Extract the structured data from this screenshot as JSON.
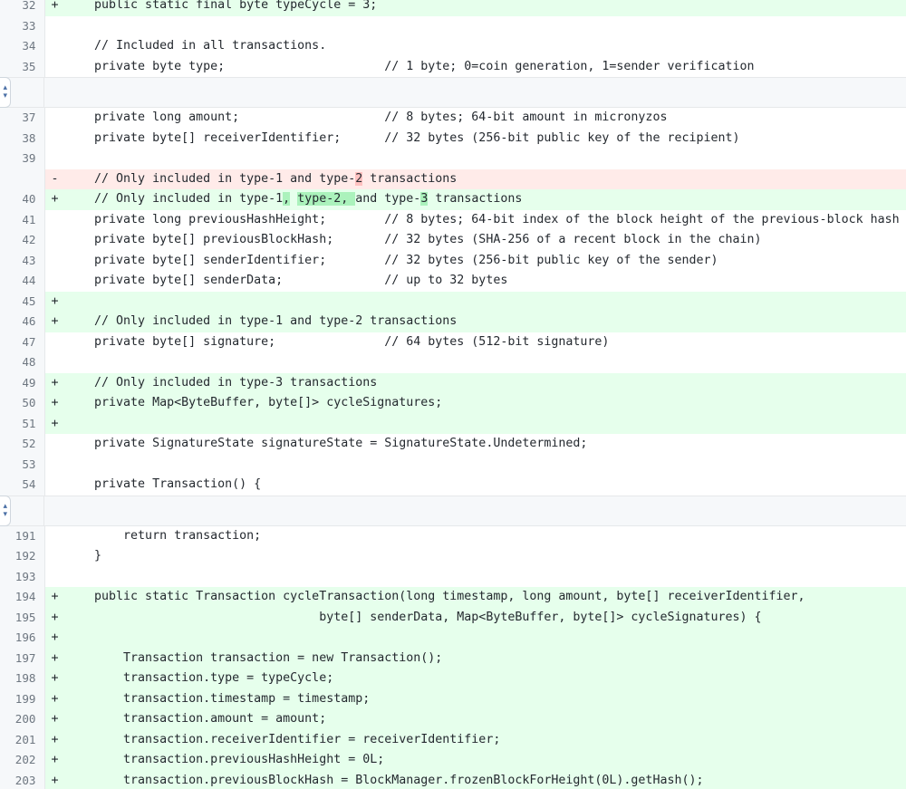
{
  "view": {
    "type": "unified-diff",
    "language": "java",
    "colors": {
      "addition_bg": "#e6ffec",
      "deletion_bg": "#ffebe9",
      "addition_word_bg": "#abf2bc",
      "deletion_word_bg": "#ffc1c0",
      "context_bg": "#ffffff",
      "gutter_bg": "#f6f8fa",
      "text": "#24292f",
      "line_number": "#6e7781",
      "border": "#e6e8ea"
    }
  },
  "expanders": [
    {
      "name": "expand-up-down-1",
      "glyph_top": "▴",
      "glyph_bottom": "▾"
    },
    {
      "name": "expand-up-down-2",
      "glyph_top": "▴",
      "glyph_bottom": "▾"
    }
  ],
  "rows": [
    {
      "num": "32",
      "marker": "+",
      "kind": "add",
      "segments": [
        {
          "text": "    public static final byte typeCycle = 3;"
        }
      ]
    },
    {
      "num": "33",
      "marker": "",
      "kind": "ctx",
      "segments": [
        {
          "text": ""
        }
      ]
    },
    {
      "num": "34",
      "marker": "",
      "kind": "ctx",
      "segments": [
        {
          "text": "    // Included in all transactions."
        }
      ]
    },
    {
      "num": "35",
      "marker": "",
      "kind": "ctx",
      "segments": [
        {
          "text": "    private byte type;                      // 1 byte; 0=coin generation, 1=sender verification"
        }
      ]
    },
    {
      "hunk": true
    },
    {
      "num": "37",
      "marker": "",
      "kind": "ctx",
      "segments": [
        {
          "text": "    private long amount;                    // 8 bytes; 64-bit amount in micronyzos"
        }
      ]
    },
    {
      "num": "38",
      "marker": "",
      "kind": "ctx",
      "segments": [
        {
          "text": "    private byte[] receiverIdentifier;      // 32 bytes (256-bit public key of the recipient)"
        }
      ]
    },
    {
      "num": "39",
      "marker": "",
      "kind": "ctx",
      "segments": [
        {
          "text": ""
        }
      ]
    },
    {
      "num": "",
      "marker": "-",
      "kind": "del",
      "segments": [
        {
          "text": "    // Only included in type-1 and type-"
        },
        {
          "text": "2",
          "hl": "del"
        },
        {
          "text": " transactions"
        }
      ]
    },
    {
      "num": "40",
      "marker": "+",
      "kind": "add",
      "segments": [
        {
          "text": "    // Only included in type-1"
        },
        {
          "text": ",",
          "hl": "add"
        },
        {
          "text": " "
        },
        {
          "text": "type-2, ",
          "hl": "add"
        },
        {
          "text": "and type-"
        },
        {
          "text": "3",
          "hl": "add"
        },
        {
          "text": " transactions"
        }
      ]
    },
    {
      "num": "41",
      "marker": "",
      "kind": "ctx",
      "segments": [
        {
          "text": "    private long previousHashHeight;        // 8 bytes; 64-bit index of the block height of the previous-block hash"
        }
      ]
    },
    {
      "num": "42",
      "marker": "",
      "kind": "ctx",
      "segments": [
        {
          "text": "    private byte[] previousBlockHash;       // 32 bytes (SHA-256 of a recent block in the chain)"
        }
      ]
    },
    {
      "num": "43",
      "marker": "",
      "kind": "ctx",
      "segments": [
        {
          "text": "    private byte[] senderIdentifier;        // 32 bytes (256-bit public key of the sender)"
        }
      ]
    },
    {
      "num": "44",
      "marker": "",
      "kind": "ctx",
      "segments": [
        {
          "text": "    private byte[] senderData;              // up to 32 bytes"
        }
      ]
    },
    {
      "num": "45",
      "marker": "+",
      "kind": "add",
      "segments": [
        {
          "text": ""
        }
      ]
    },
    {
      "num": "46",
      "marker": "+",
      "kind": "add",
      "segments": [
        {
          "text": "    // Only included in type-1 and type-2 transactions"
        }
      ]
    },
    {
      "num": "47",
      "marker": "",
      "kind": "ctx",
      "segments": [
        {
          "text": "    private byte[] signature;               // 64 bytes (512-bit signature)"
        }
      ]
    },
    {
      "num": "48",
      "marker": "",
      "kind": "ctx",
      "segments": [
        {
          "text": ""
        }
      ]
    },
    {
      "num": "49",
      "marker": "+",
      "kind": "add",
      "segments": [
        {
          "text": "    // Only included in type-3 transactions"
        }
      ]
    },
    {
      "num": "50",
      "marker": "+",
      "kind": "add",
      "segments": [
        {
          "text": "    private Map<ByteBuffer, byte[]> cycleSignatures;"
        }
      ]
    },
    {
      "num": "51",
      "marker": "+",
      "kind": "add",
      "segments": [
        {
          "text": ""
        }
      ]
    },
    {
      "num": "52",
      "marker": "",
      "kind": "ctx",
      "segments": [
        {
          "text": "    private SignatureState signatureState = SignatureState.Undetermined;"
        }
      ]
    },
    {
      "num": "53",
      "marker": "",
      "kind": "ctx",
      "segments": [
        {
          "text": ""
        }
      ]
    },
    {
      "num": "54",
      "marker": "",
      "kind": "ctx",
      "segments": [
        {
          "text": "    private Transaction() {"
        }
      ]
    },
    {
      "hunk": true
    },
    {
      "num": "191",
      "marker": "",
      "kind": "ctx",
      "segments": [
        {
          "text": "        return transaction;"
        }
      ]
    },
    {
      "num": "192",
      "marker": "",
      "kind": "ctx",
      "segments": [
        {
          "text": "    }"
        }
      ]
    },
    {
      "num": "193",
      "marker": "",
      "kind": "ctx",
      "segments": [
        {
          "text": ""
        }
      ]
    },
    {
      "num": "194",
      "marker": "+",
      "kind": "add",
      "segments": [
        {
          "text": "    public static Transaction cycleTransaction(long timestamp, long amount, byte[] receiverIdentifier,"
        }
      ]
    },
    {
      "num": "195",
      "marker": "+",
      "kind": "add",
      "segments": [
        {
          "text": "                                   byte[] senderData, Map<ByteBuffer, byte[]> cycleSignatures) {"
        }
      ]
    },
    {
      "num": "196",
      "marker": "+",
      "kind": "add",
      "segments": [
        {
          "text": ""
        }
      ]
    },
    {
      "num": "197",
      "marker": "+",
      "kind": "add",
      "segments": [
        {
          "text": "        Transaction transaction = new Transaction();"
        }
      ]
    },
    {
      "num": "198",
      "marker": "+",
      "kind": "add",
      "segments": [
        {
          "text": "        transaction.type = typeCycle;"
        }
      ]
    },
    {
      "num": "199",
      "marker": "+",
      "kind": "add",
      "segments": [
        {
          "text": "        transaction.timestamp = timestamp;"
        }
      ]
    },
    {
      "num": "200",
      "marker": "+",
      "kind": "add",
      "segments": [
        {
          "text": "        transaction.amount = amount;"
        }
      ]
    },
    {
      "num": "201",
      "marker": "+",
      "kind": "add",
      "segments": [
        {
          "text": "        transaction.receiverIdentifier = receiverIdentifier;"
        }
      ]
    },
    {
      "num": "202",
      "marker": "+",
      "kind": "add",
      "segments": [
        {
          "text": "        transaction.previousHashHeight = 0L;"
        }
      ]
    },
    {
      "num": "203",
      "marker": "+",
      "kind": "add",
      "segments": [
        {
          "text": "        transaction.previousBlockHash = BlockManager.frozenBlockForHeight(0L).getHash();"
        }
      ]
    }
  ]
}
